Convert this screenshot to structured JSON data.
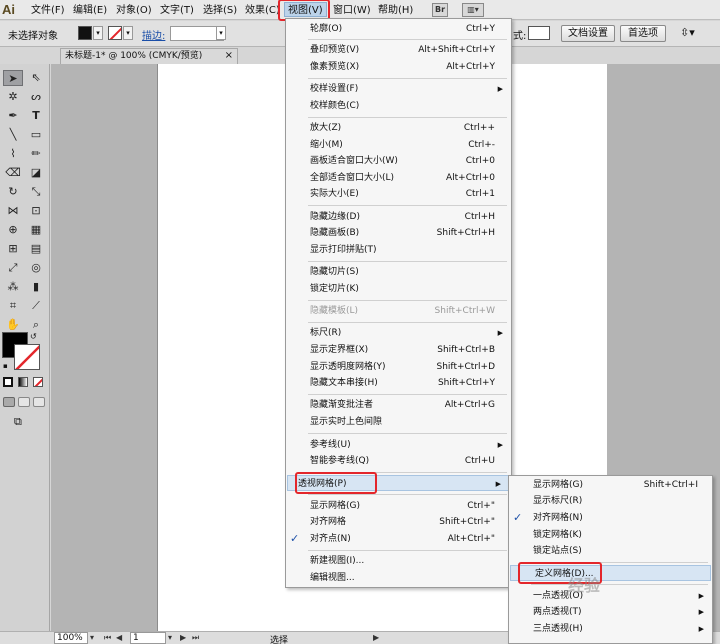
{
  "menubar": {
    "logo": "Ai",
    "items": [
      "文件(F)",
      "编辑(E)",
      "对象(O)",
      "文字(T)",
      "选择(S)",
      "效果(C)",
      "视图(V)",
      "窗口(W)",
      "帮助(H)"
    ],
    "icons": [
      "Br"
    ]
  },
  "controlbar": {
    "selection_status": "未选择对象",
    "stroke_label": "描边:",
    "right_label": "式:",
    "doc_setup": "文档设置",
    "prefs": "首选项"
  },
  "document_tab": {
    "title": "未标题-1* @ 100% (CMYK/预览)",
    "close": "×"
  },
  "statusbar": {
    "zoom": "100%",
    "page": "1",
    "tool": "选择"
  },
  "view_menu": {
    "items": [
      {
        "label": "轮廓(O)",
        "shortcut": "Ctrl+Y"
      },
      {
        "label": "叠印预览(V)",
        "shortcut": "Alt+Shift+Ctrl+Y"
      },
      {
        "label": "像素预览(X)",
        "shortcut": "Alt+Ctrl+Y"
      },
      {
        "label": "校样设置(F)",
        "shortcut": ""
      },
      {
        "label": "校样颜色(C)",
        "shortcut": ""
      },
      {
        "label": "放大(Z)",
        "shortcut": "Ctrl++"
      },
      {
        "label": "缩小(M)",
        "shortcut": "Ctrl+-"
      },
      {
        "label": "画板适合窗口大小(W)",
        "shortcut": "Ctrl+0"
      },
      {
        "label": "全部适合窗口大小(L)",
        "shortcut": "Alt+Ctrl+0"
      },
      {
        "label": "实际大小(E)",
        "shortcut": "Ctrl+1"
      },
      {
        "label": "隐藏边缘(D)",
        "shortcut": "Ctrl+H"
      },
      {
        "label": "隐藏画板(B)",
        "shortcut": "Shift+Ctrl+H"
      },
      {
        "label": "显示打印拼贴(T)",
        "shortcut": ""
      },
      {
        "label": "隐藏切片(S)",
        "shortcut": ""
      },
      {
        "label": "锁定切片(K)",
        "shortcut": ""
      },
      {
        "label": "隐藏模板(L)",
        "shortcut": "Shift+Ctrl+W"
      },
      {
        "label": "标尺(R)",
        "shortcut": ""
      },
      {
        "label": "显示定界框(X)",
        "shortcut": "Shift+Ctrl+B"
      },
      {
        "label": "显示透明度网格(Y)",
        "shortcut": "Shift+Ctrl+D"
      },
      {
        "label": "隐藏文本串接(H)",
        "shortcut": "Shift+Ctrl+Y"
      },
      {
        "label": "隐藏渐变批注者",
        "shortcut": "Alt+Ctrl+G"
      },
      {
        "label": "显示实时上色间隙",
        "shortcut": ""
      },
      {
        "label": "参考线(U)",
        "shortcut": ""
      },
      {
        "label": "智能参考线(Q)",
        "shortcut": "Ctrl+U"
      },
      {
        "label": "透视网格(P)",
        "shortcut": ""
      },
      {
        "label": "显示网格(G)",
        "shortcut": "Ctrl+\""
      },
      {
        "label": "对齐网格",
        "shortcut": "Shift+Ctrl+\""
      },
      {
        "label": "对齐点(N)",
        "shortcut": "Alt+Ctrl+\""
      },
      {
        "label": "新建视图(I)...",
        "shortcut": ""
      },
      {
        "label": "编辑视图...",
        "shortcut": ""
      }
    ]
  },
  "perspective_menu": {
    "items": [
      {
        "label": "显示网格(G)",
        "shortcut": "Shift+Ctrl+I"
      },
      {
        "label": "显示标尺(R)",
        "shortcut": ""
      },
      {
        "label": "对齐网格(N)",
        "shortcut": ""
      },
      {
        "label": "锁定网格(K)",
        "shortcut": ""
      },
      {
        "label": "锁定站点(S)",
        "shortcut": ""
      },
      {
        "label": "定义网格(D)...",
        "shortcut": ""
      },
      {
        "label": "一点透视(O)",
        "shortcut": ""
      },
      {
        "label": "两点透视(T)",
        "shortcut": ""
      },
      {
        "label": "三点透视(H)",
        "shortcut": ""
      }
    ]
  },
  "watermark": "经验",
  "colors": {
    "highlight_red": "#e3262b",
    "menu_hover": "#d7e5f3",
    "check_blue": "#1d50a8"
  }
}
